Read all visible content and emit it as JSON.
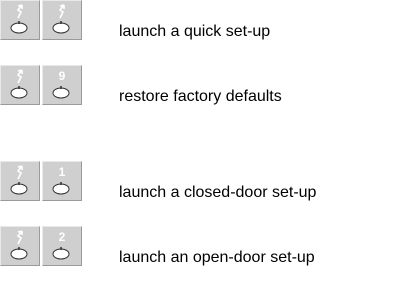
{
  "instructions": [
    {
      "key1_icon": "knob-with-arrow-icon",
      "key2_icon": "knob-with-arrow-icon",
      "key2_digit": "",
      "description": "launch a quick set-up"
    },
    {
      "key1_icon": "knob-with-arrow-icon",
      "key2_icon": "knob-with-digit-icon",
      "key2_digit": "9",
      "description": "restore factory defaults"
    },
    {
      "key1_icon": "knob-with-arrow-icon",
      "key2_icon": "knob-with-digit-icon",
      "key2_digit": "1",
      "description": "launch a closed-door set-up"
    },
    {
      "key1_icon": "knob-with-arrow-icon",
      "key2_icon": "knob-with-digit-icon",
      "key2_digit": "2",
      "description": "launch an open-door set-up"
    }
  ],
  "colors": {
    "key_face": "#cfcfcf",
    "symbol": "#ffffff",
    "knob_outline": "#333333"
  }
}
